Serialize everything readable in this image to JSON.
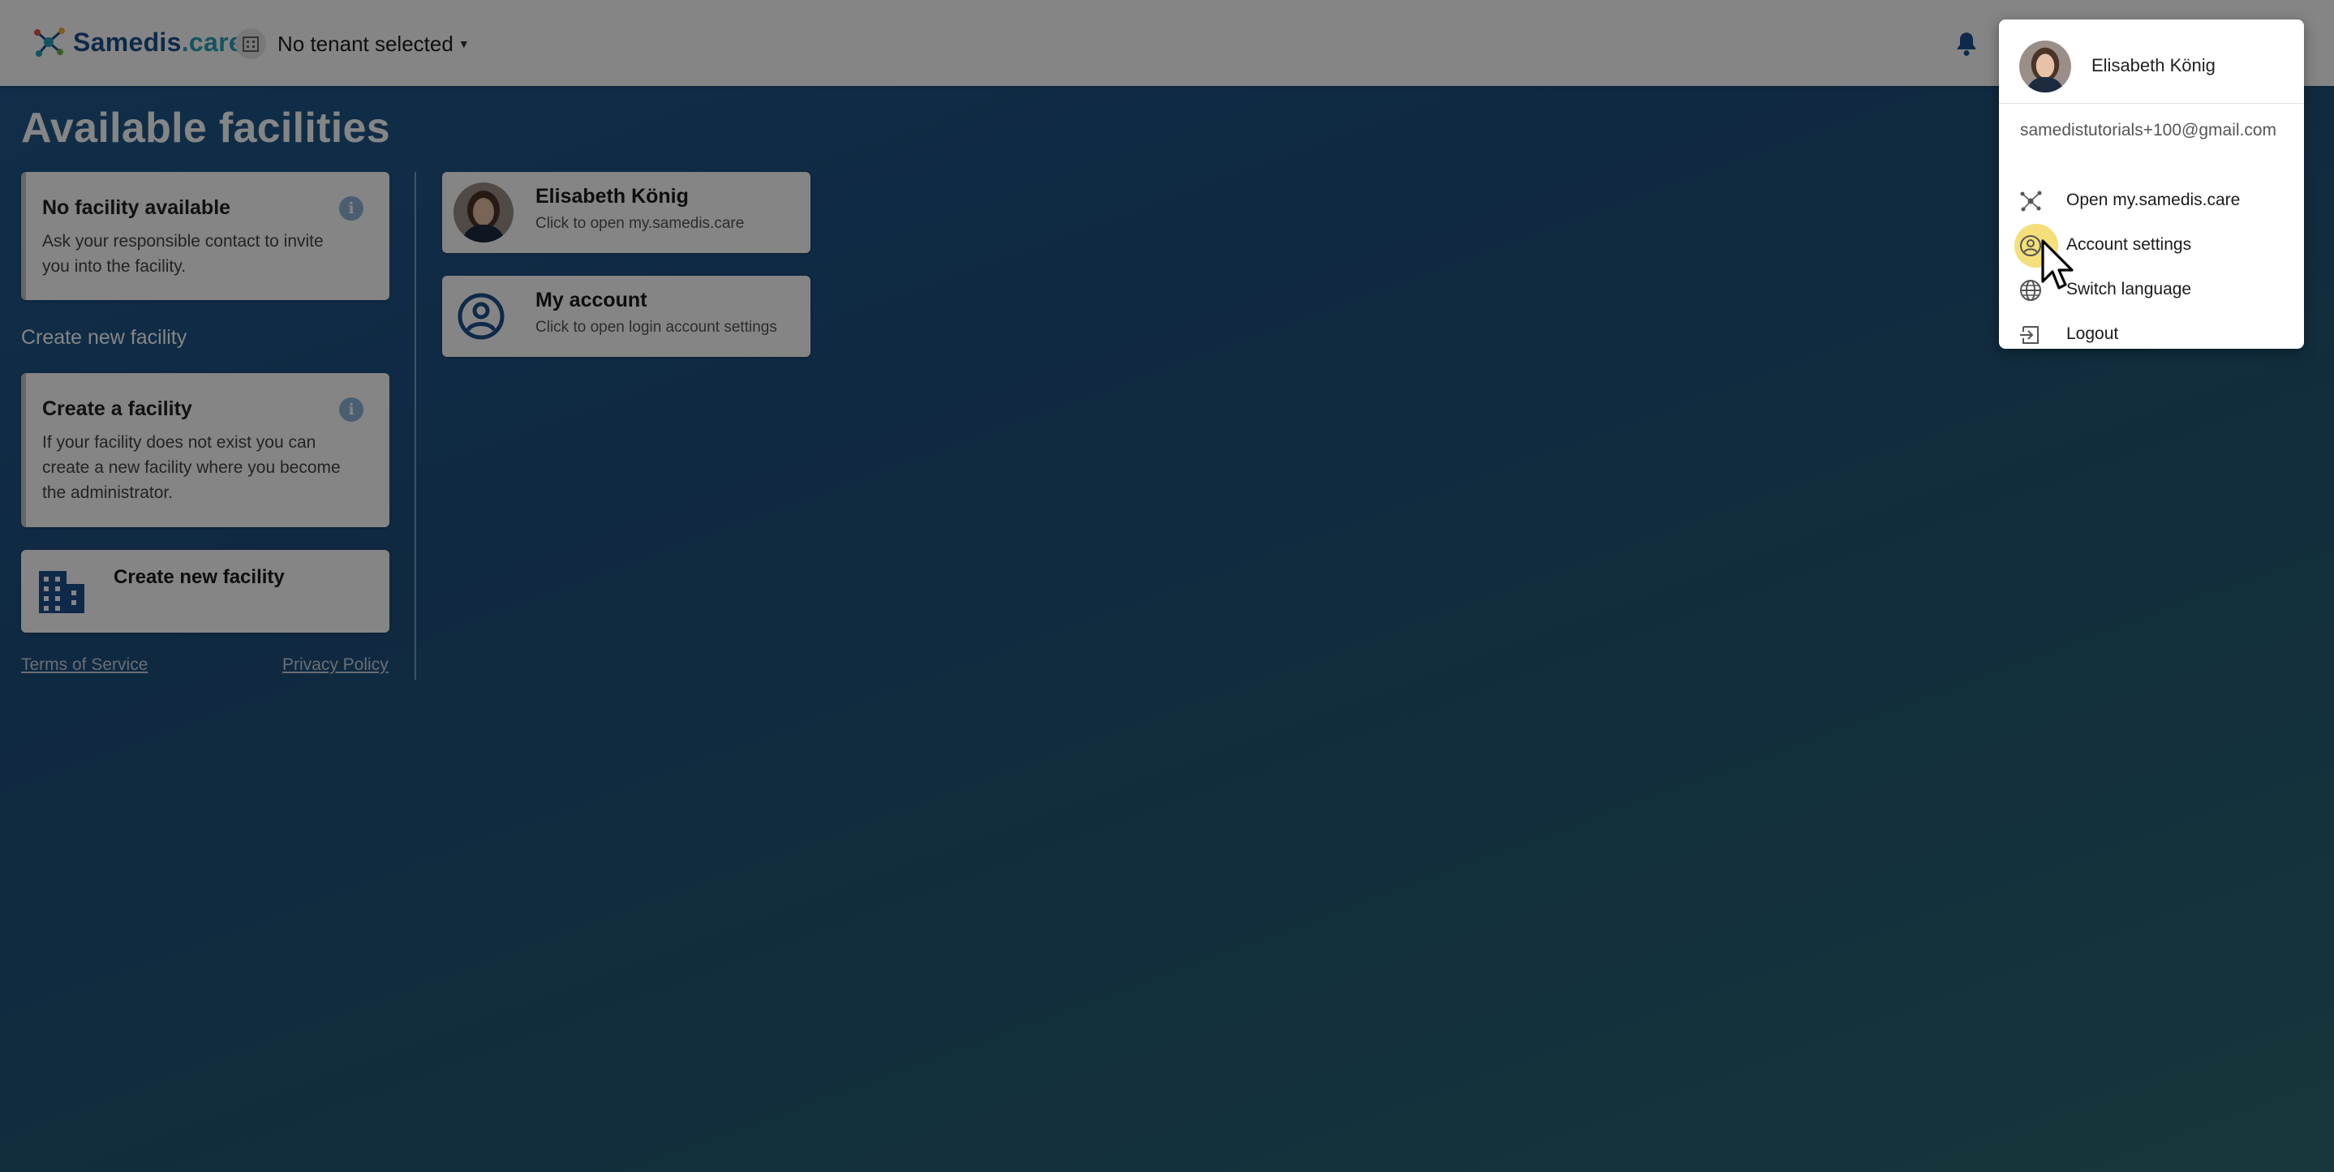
{
  "header": {
    "logo_main": "Samedis",
    "logo_suffix": ".care",
    "tenant_label": "No tenant selected"
  },
  "page": {
    "title": "Available facilities"
  },
  "no_facility_card": {
    "title": "No facility available",
    "text": "Ask your responsible contact to invite you into the facility."
  },
  "create_section": {
    "heading": "Create new facility"
  },
  "create_info_card": {
    "title": "Create a facility",
    "text": "If your facility does not exist you can create a new facility where you become the administrator."
  },
  "create_button": {
    "label": "Create new facility"
  },
  "footer": {
    "terms": "Terms of Service",
    "privacy": "Privacy Policy"
  },
  "tiles": {
    "profile": {
      "title": "Elisabeth König",
      "subtitle": "Click to open my.samedis.care"
    },
    "account": {
      "title": "My account",
      "subtitle": "Click to open login account settings"
    }
  },
  "user_menu": {
    "name": "Elisabeth König",
    "email": "samedistutorials+100@gmail.com",
    "items": [
      {
        "label": "Open my.samedis.care",
        "icon": "network-icon"
      },
      {
        "label": "Account settings",
        "icon": "account-circle-icon"
      },
      {
        "label": "Switch language",
        "icon": "globe-icon"
      },
      {
        "label": "Logout",
        "icon": "logout-icon"
      }
    ]
  },
  "colors": {
    "brand_blue": "#1c4f8c",
    "brand_teal": "#2aa0b8",
    "highlight": "#f4df7a"
  }
}
